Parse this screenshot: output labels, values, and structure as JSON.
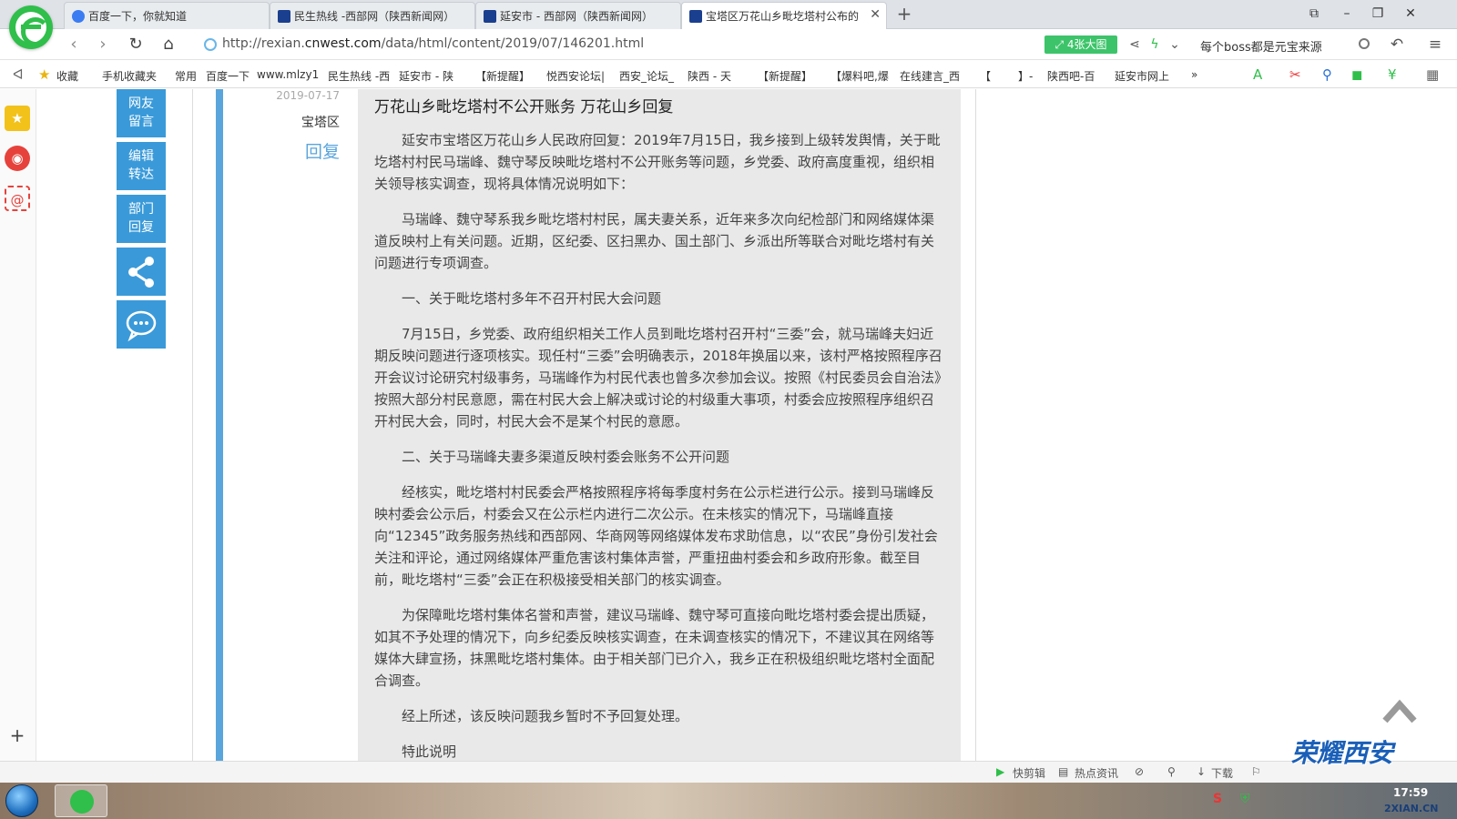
{
  "tabs": [
    {
      "label": "百度一下，你就知道",
      "favicon": "baidu-icon"
    },
    {
      "label": "民生热线 -西部网（陕西新闻网）",
      "favicon": "cnwest-icon"
    },
    {
      "label": "延安市 - 西部网（陕西新闻网）",
      "favicon": "cnwest-icon"
    },
    {
      "label": "宝塔区万花山乡毗圪塔村公布的",
      "favicon": "cnwest-icon"
    }
  ],
  "address": {
    "prefix": "http://rexian.",
    "host": "cnwest.com",
    "path": "/data/html/content/2019/07/146201.html"
  },
  "toolbar": {
    "big_image": "4张大图",
    "search_text": "每个boss都是元宝来源"
  },
  "bookmarks": [
    "收藏",
    "手机收藏夹",
    "常用",
    "百度一下",
    "www.mlzy1",
    "民生热线 -西",
    "延安市 - 陕",
    "【新提醒】",
    "悦西安论坛|",
    "西安_论坛_",
    "陕西 - 天",
    "【新提醒】",
    "【爆料吧,爆",
    "在线建言_西",
    "【",
    "】-",
    "陕西吧-百",
    "延安市网上",
    "»"
  ],
  "side_buttons": [
    {
      "line1": "网友",
      "line2": "留言"
    },
    {
      "line1": "编辑",
      "line2": "转达"
    },
    {
      "line1": "部门",
      "line2": "回复"
    }
  ],
  "meta": {
    "date": "2019-07-17",
    "district": "宝塔区",
    "reply_label": "回复"
  },
  "article": {
    "title": "万花山乡毗圪塔村不公开账务 万花山乡回复",
    "paragraphs": [
      "延安市宝塔区万花山乡人民政府回复：2019年7月15日，我乡接到上级转发舆情，关于毗圪塔村村民马瑞峰、魏守琴反映毗圪塔村不公开账务等问题，乡党委、政府高度重视，组织相关领导核实调查，现将具体情况说明如下：",
      "马瑞峰、魏守琴系我乡毗圪塔村村民，属夫妻关系，近年来多次向纪检部门和网络媒体渠道反映村上有关问题。近期，区纪委、区扫黑办、国土部门、乡派出所等联合对毗圪塔村有关问题进行专项调查。",
      "一、关于毗圪塔村多年不召开村民大会问题",
      "7月15日，乡党委、政府组织相关工作人员到毗圪塔村召开村“三委”会，就马瑞峰夫妇近期反映问题进行逐项核实。现任村“三委”会明确表示，2018年换届以来，该村严格按照程序召开会议讨论研究村级事务，马瑞峰作为村民代表也曾多次参加会议。按照《村民委员会自治法》按照大部分村民意愿，需在村民大会上解决或讨论的村级重大事项，村委会应按照程序组织召开村民大会，同时，村民大会不是某个村民的意愿。",
      "二、关于马瑞峰夫妻多渠道反映村委会账务不公开问题",
      "经核实，毗圪塔村村民委会严格按照程序将每季度村务在公示栏进行公示。接到马瑞峰反映村委会公示后，村委会又在公示栏内进行二次公示。在未核实的情况下，马瑞峰直接向“12345”政务服务热线和西部网、华商网等网络媒体发布求助信息，以“农民”身份引发社会关注和评论，通过网络媒体严重危害该村集体声誉，严重扭曲村委会和乡政府形象。截至目前，毗圪塔村“三委”会正在积极接受相关部门的核实调查。",
      "为保障毗圪塔村集体名誉和声誉，建议马瑞峰、魏守琴可直接向毗圪塔村委会提出质疑，如其不予处理的情况下，向乡纪委反映核实调查，在未调查核实的情况下，不建议其在网络等媒体大肆宣扬，抹黑毗圪塔村集体。由于相关部门已介入，我乡正在积极组织毗圪塔村全面配合调查。",
      "经上所述，该反映问题我乡暂时不予回复处理。",
      "特此说明"
    ]
  },
  "statusbar": [
    "快剪辑",
    "热点资讯",
    "下载"
  ],
  "taskbar": {
    "clock": "17:59"
  },
  "watermark": {
    "main": "荣耀西安",
    "sub": "2XIAN.CN"
  },
  "colors": {
    "accent": "#3a9ad9",
    "reply": "#5aa5dc",
    "brand_green": "#2fbf4a"
  }
}
